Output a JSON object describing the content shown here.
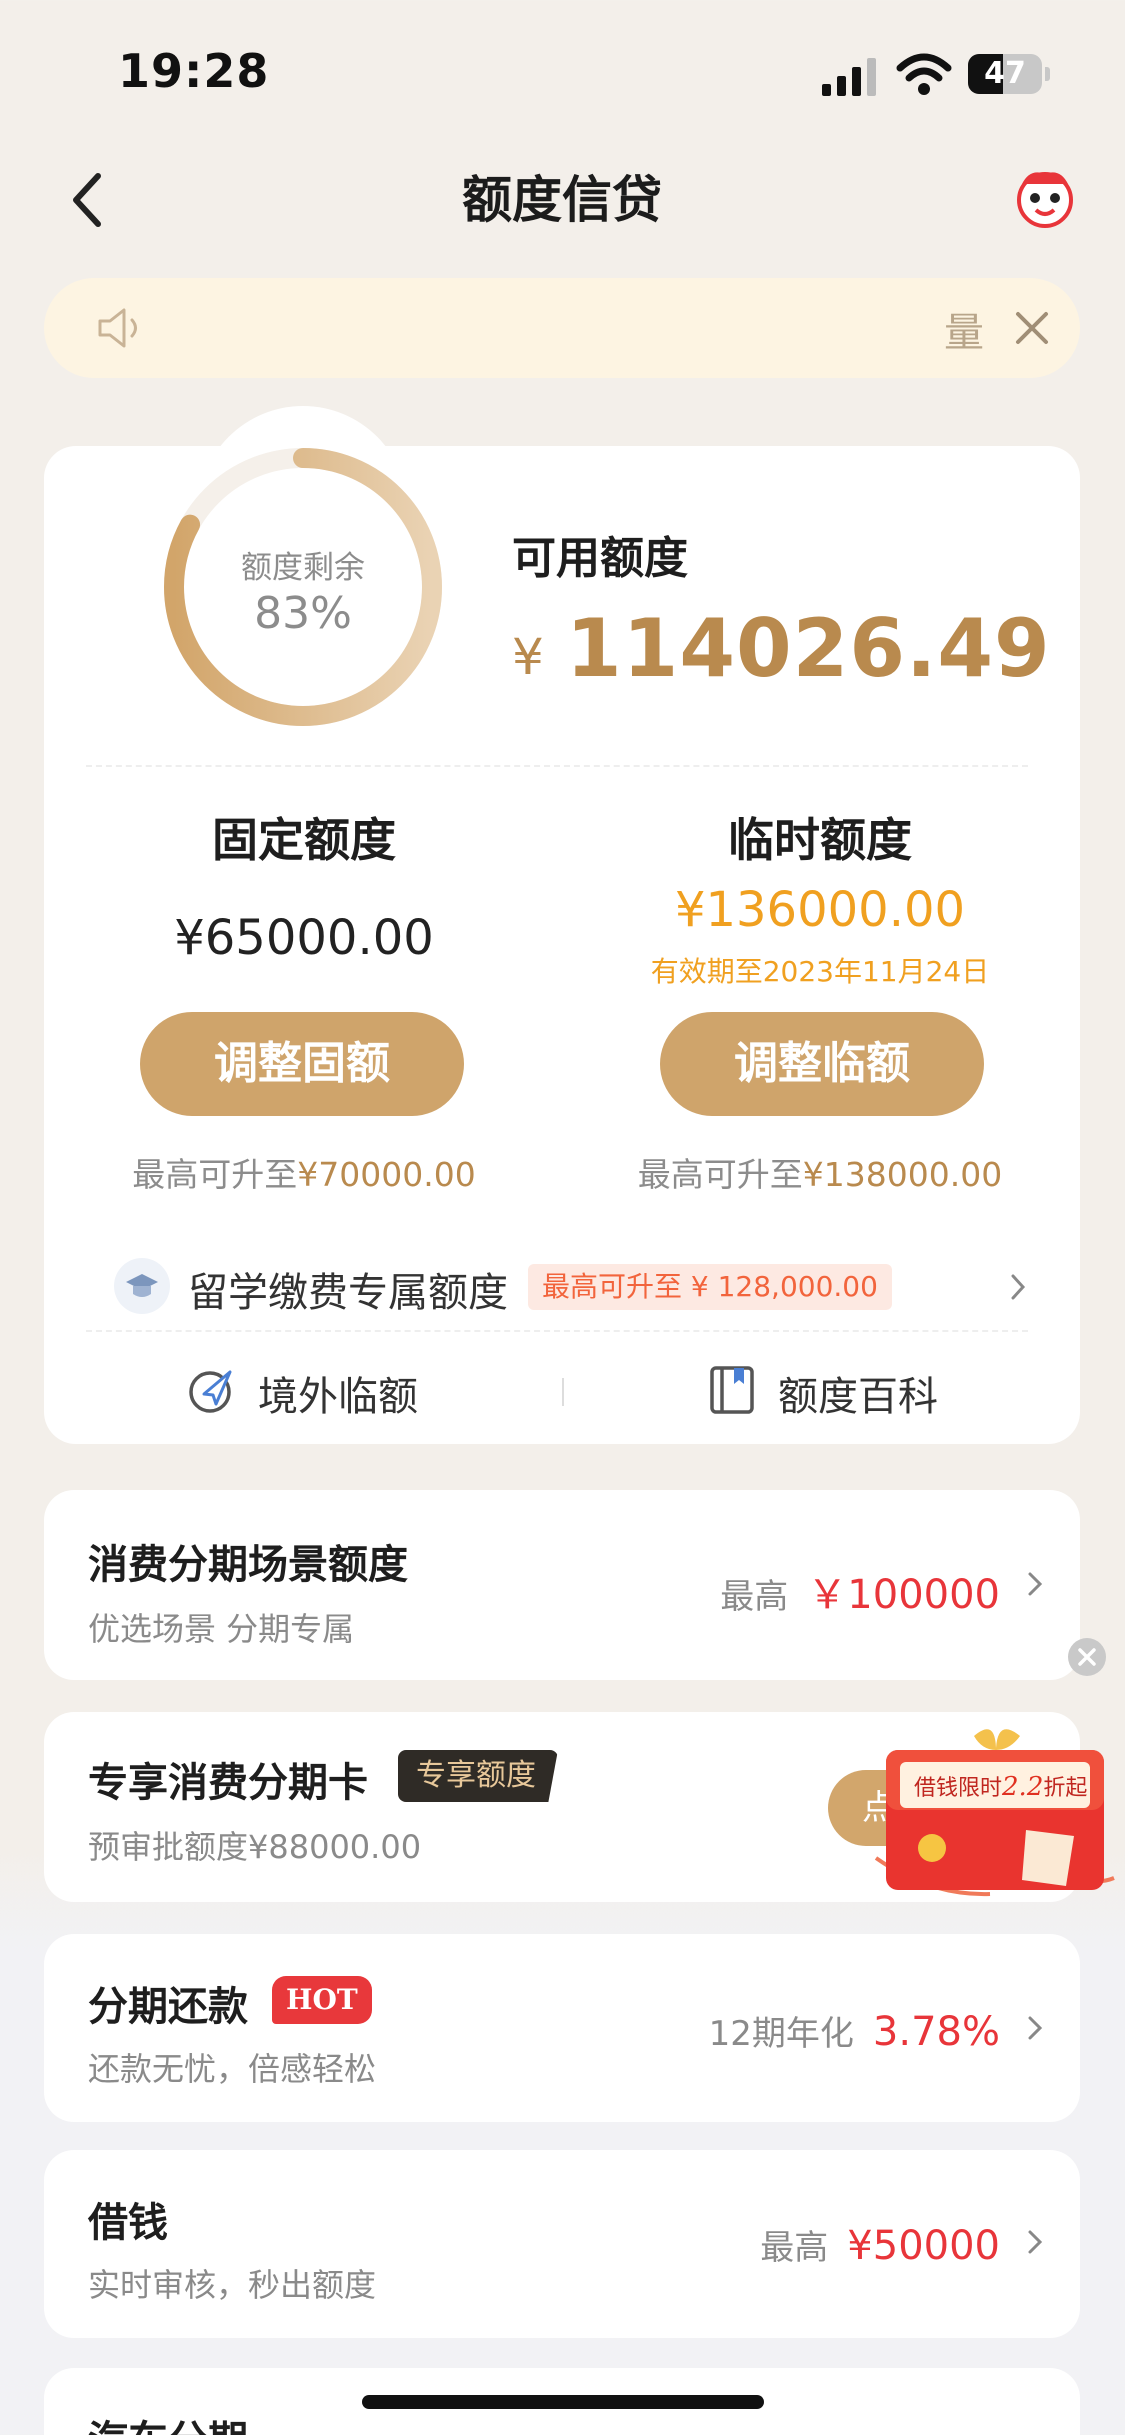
{
  "status_bar": {
    "time": "19:28",
    "battery": "47",
    "battery_level": 0.47
  },
  "nav": {
    "title": "额度信贷",
    "back_icon": "chevron-left-icon",
    "mascot_icon": "mascot-icon"
  },
  "notice": {
    "text": "量",
    "speaker_icon": "speaker-icon",
    "close_icon": "close-icon"
  },
  "quota": {
    "ring_label": "额度剩余",
    "ring_percent_text": "83%",
    "ring_percent": 83,
    "available_label": "可用额度",
    "currency": "¥",
    "available_amount": "114026.49"
  },
  "fixed": {
    "title": "固定额度",
    "amount": "¥65000.00",
    "button": "调整固额",
    "max_prefix": "最高可升至",
    "max_value": "¥70000.00"
  },
  "temp": {
    "title": "临时额度",
    "amount": "¥136000.00",
    "validity": "有效期至2023年11月24日",
    "button": "调整临额",
    "max_prefix": "最高可升至",
    "max_value": "¥138000.00"
  },
  "study": {
    "label": "留学缴费专属额度",
    "badge": "最高可升至 ¥ 128,000.00",
    "icon": "graduation-cap-icon"
  },
  "quick_links": [
    {
      "label": "境外临额",
      "icon": "plane-globe-icon"
    },
    {
      "label": "额度百科",
      "icon": "book-icon"
    }
  ],
  "cards": {
    "consumer_scene": {
      "title": "消费分期场景额度",
      "subtitle": "优选场景 分期专属",
      "right_label": "最高",
      "right_value": "￥100000"
    },
    "exclusive_card": {
      "title": "专享消费分期卡",
      "tag": "专享额度",
      "subtitle": "预审批额度¥88000.00",
      "button_text": "点"
    },
    "installment": {
      "title": "分期还款",
      "tag": "HOT",
      "subtitle": "还款无忧，倍感轻松",
      "right_label": "12期年化",
      "right_value": "3.78%"
    },
    "borrow": {
      "title": "借钱",
      "subtitle": "实时审核，秒出额度",
      "right_label": "最高",
      "right_value": "¥50000"
    },
    "car": {
      "title": "汽车分期"
    }
  },
  "promo": {
    "text_1": "借钱限时",
    "text_2": "2.2",
    "text_3": "折起"
  },
  "colors": {
    "gold": "#b98a4e",
    "button_gold": "#cfa46b",
    "orange": "#f0a020",
    "red": "#e8353a"
  }
}
